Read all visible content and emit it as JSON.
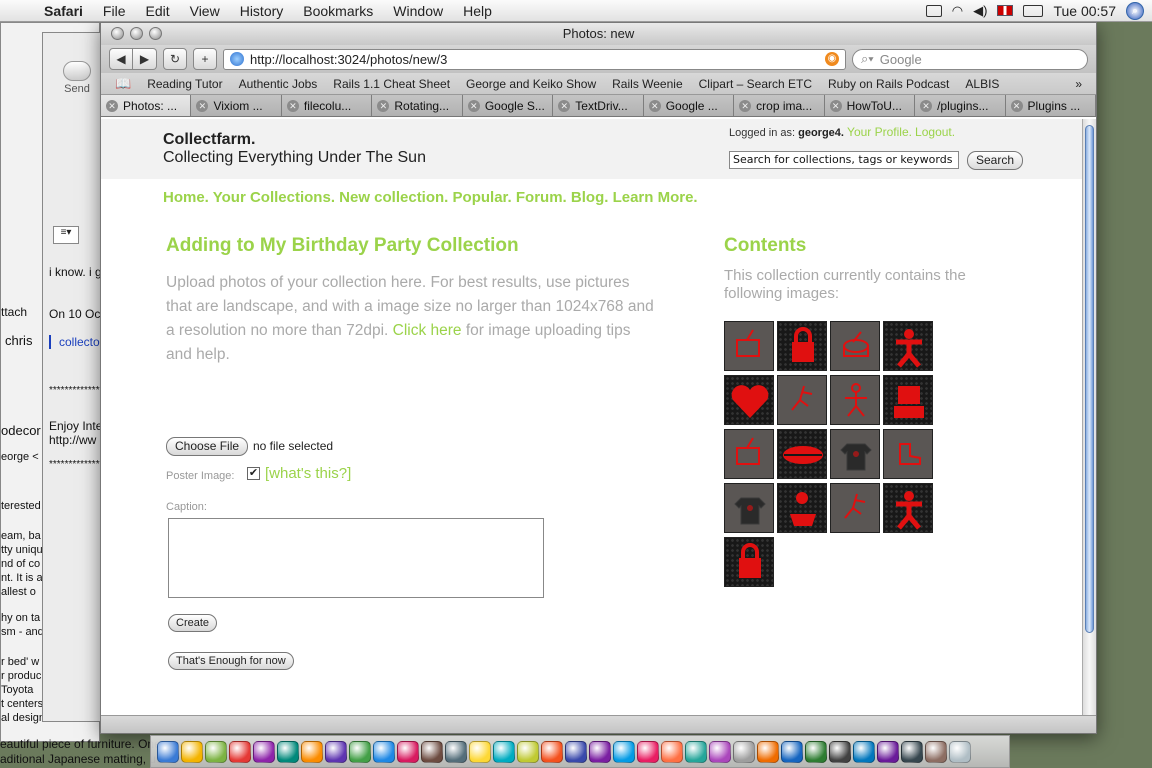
{
  "menubar": {
    "app": "Safari",
    "items": [
      "File",
      "Edit",
      "View",
      "History",
      "Bookmarks",
      "Window",
      "Help"
    ],
    "clock": "Tue 00:57"
  },
  "bg_mail": {
    "send": "Send",
    "snippets": [
      "i know. i g",
      "On 10 Oc",
      "collecto",
      "*************",
      "Enjoy Inte",
      "http://ww",
      "*************"
    ],
    "left_snippets": [
      "ttach",
      "chris",
      "odecor",
      "eorge <",
      "terested",
      "eam, ba",
      "tty uniqu",
      "nd of co",
      "nt. It is a",
      "allest o",
      "hy on ta",
      "sm - and",
      "r bed' w",
      "r produc",
      "Toyota",
      "t centers",
      "al design"
    ],
    "bottom_text": "eautiful piece of furniture. One scroll",
    "bottom_text2": "aditional Japanese matting, us"
  },
  "browser": {
    "title": "Photos: new",
    "url": "http://localhost:3024/photos/new/3",
    "search_placeholder": "Google",
    "bookmarks": [
      "Reading Tutor",
      "Authentic Jobs",
      "Rails 1.1 Cheat Sheet",
      "George and Keiko Show",
      "Rails Weenie",
      "Clipart – Search ETC",
      "Ruby on Rails Podcast",
      "ALBIS"
    ],
    "tabs": [
      "Photos: ...",
      "Vixiom ...",
      "filecolu...",
      "Rotating...",
      "Google S...",
      "TextDriv...",
      "Google ...",
      "crop ima...",
      "HowToU...",
      "/plugins...",
      "Plugins ..."
    ]
  },
  "site": {
    "brand": "Collectfarm.",
    "tagline": "Collecting Everything Under The Sun",
    "logged_in_prefix": "Logged in as:",
    "username": "george4.",
    "profile_link": "Your Profile.",
    "logout_link": "Logout.",
    "search_value": "Search for collections, tags or keywords",
    "search_button": "Search",
    "nav": [
      "Home.",
      "Your Collections.",
      "New collection.",
      "Popular.",
      "Forum.",
      "Blog.",
      "Learn More."
    ]
  },
  "form": {
    "heading": "Adding to My Birthday Party Collection",
    "intro_before": "Upload photos of your collection here. For best results, use pictures that are landscape, and with a image size no larger than 1024x768 and a resolution no more than 72dpi.",
    "intro_link": "Click here",
    "intro_after": "for image uploading tips and help.",
    "choose_file": "Choose File",
    "file_status": "no file selected",
    "poster_label": "Poster Image:",
    "poster_checked": true,
    "whats_this": "[what's this?]",
    "caption_label": "Caption:",
    "caption_value": "",
    "create_button": "Create",
    "enough_button": "That's Enough for now"
  },
  "contents": {
    "heading": "Contents",
    "description": "This collection currently contains the following images:",
    "thumbnails": [
      {
        "style": "grey",
        "icon": "tv-icon"
      },
      {
        "style": "dark",
        "icon": "lock-icon"
      },
      {
        "style": "grey",
        "icon": "drum-icon"
      },
      {
        "style": "dark",
        "icon": "figure-icon"
      },
      {
        "style": "dark",
        "icon": "heart-icon"
      },
      {
        "style": "grey",
        "icon": "runner-icon"
      },
      {
        "style": "grey",
        "icon": "stick-figure-icon"
      },
      {
        "style": "dark",
        "icon": "robot-icon"
      },
      {
        "style": "grey",
        "icon": "tv-icon"
      },
      {
        "style": "dark",
        "icon": "lips-icon"
      },
      {
        "style": "grey",
        "icon": "shirt-icon"
      },
      {
        "style": "grey",
        "icon": "boot-icon"
      },
      {
        "style": "grey",
        "icon": "shirt-icon"
      },
      {
        "style": "dark",
        "icon": "duck-icon"
      },
      {
        "style": "grey",
        "icon": "runner-icon"
      },
      {
        "style": "dark",
        "icon": "figure-icon"
      },
      {
        "style": "dark",
        "icon": "lock-icon"
      }
    ]
  },
  "colors": {
    "accent_green": "#9bd34a",
    "thumb_red": "#e01010"
  }
}
